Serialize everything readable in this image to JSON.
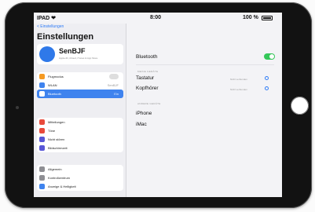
{
  "statusbar": {
    "carrier": "IPAD ❤",
    "time": "8:00",
    "battery_text": "100 %"
  },
  "sidebar": {
    "back_label": "< Einstellungen",
    "title": "Einstellungen",
    "profile": {
      "name": "SenBJF",
      "subtitle": "Apple-ID, iCloud, iTunes & App Store"
    },
    "group1": [
      {
        "label": "Flugmodus",
        "icon_color": "#f59a23",
        "value": "",
        "toggle": true
      },
      {
        "label": "WLAN",
        "icon_color": "#3f83ee",
        "value": "SenBJF",
        "toggle": false
      },
      {
        "label": "Bluetooth",
        "icon_color": "#ffffff",
        "value": "Ein",
        "toggle": false,
        "selected": true
      }
    ],
    "group2": [
      {
        "label": "Mitteilungen",
        "icon_color": "#e84a3c"
      },
      {
        "label": "Töne",
        "icon_color": "#e84a3c"
      },
      {
        "label": "Nicht stören",
        "icon_color": "#5856d6"
      },
      {
        "label": "Bildschirmzeit",
        "icon_color": "#5856d6"
      }
    ],
    "group3": [
      {
        "label": "Allgemein",
        "icon_color": "#8e8e93"
      },
      {
        "label": "Kontrollzentrum",
        "icon_color": "#8e8e93"
      },
      {
        "label": "Anzeige & Helligkeit",
        "icon_color": "#3f83ee"
      }
    ]
  },
  "detail": {
    "bluetooth_label": "Bluetooth",
    "bluetooth_on": true,
    "my_devices_header": "MEINE GERÄTE",
    "my_devices": [
      {
        "name": "Tastatur",
        "status": "Nicht verbunden"
      },
      {
        "name": "Kopfhörer",
        "status": "Nicht verbunden"
      }
    ],
    "other_devices_header": "ANDERE GERÄTE",
    "other_devices": [
      {
        "name": "iPhone"
      },
      {
        "name": "iMac"
      }
    ]
  },
  "colors": {
    "accent": "#2f7cf6",
    "toggle_on": "#34c759",
    "bezel": "#121212"
  }
}
